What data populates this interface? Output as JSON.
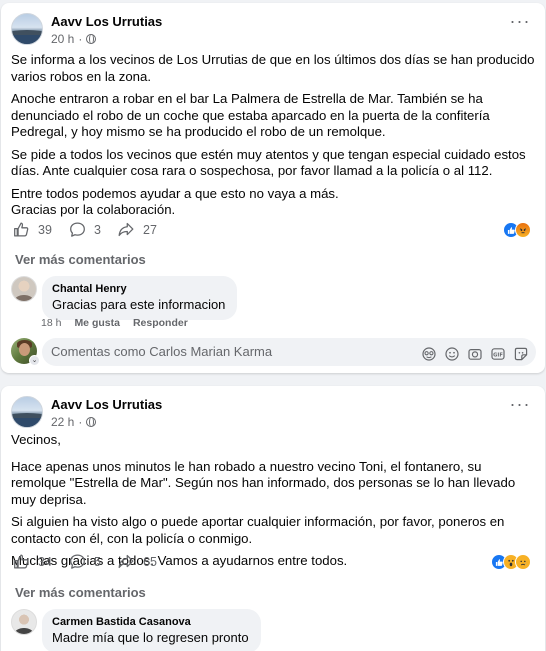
{
  "posts": [
    {
      "page_name": "Aavv Los Urrutias",
      "time": "20 h",
      "paragraphs": [
        "Se informa a los vecinos de Los Urrutias de que en los últimos dos días se han producido varios robos en la zona.",
        "Anoche entraron a robar en el bar La Palmera de Estrella de Mar. También se ha denunciado el robo de un coche que estaba aparcado en la puerta de la confitería Pedregal, y hoy mismo se ha producido el robo de un remolque.",
        "Se pide a todos los vecinos que estén muy atentos y que tengan especial cuidado estos días. Ante cualquier cosa rara o sospechosa, por favor llamad a la policía o al 112.",
        "Entre todos podemos ayudar a que esto no vaya a más.\nGracias por la colaboración."
      ],
      "likes": "39",
      "comments_count": "3",
      "shares": "27",
      "reactions": [
        "like-icon",
        "angry-icon"
      ],
      "more_comments": "Ver más comentarios",
      "comment": {
        "author": "Chantal Henry",
        "text": "Gracias para este informacion",
        "time": "18 h",
        "like_label": "Me gusta",
        "reply_label": "Responder"
      },
      "composer_placeholder": "Comentas como Carlos Marian Karma"
    },
    {
      "page_name": "Aavv Los Urrutias",
      "time": "22 h",
      "paragraphs": [
        "Vecinos,",
        "Hace apenas unos minutos le han robado a nuestro vecino Toni, el fontanero, su remolque \"Estrella de Mar\". Según nos han informado, dos personas se lo han llevado muy deprisa.",
        "Si alguien ha visto algo o puede aportar cualquier información, por favor, poneros en contacto con él, con la policía o conmigo.",
        "Muchas gracias a todos. Vamos a ayudarnos entre todos."
      ],
      "likes": "34",
      "comments_count": "5",
      "shares": "65",
      "reactions": [
        "like-icon",
        "wow-icon",
        "sad-icon"
      ],
      "more_comments": "Ver más comentarios",
      "comment": {
        "author": "Carmen Bastida Casanova",
        "text": "Madre mía que lo regresen pronto"
      }
    }
  ],
  "colors": {
    "background": "#f0f2f5",
    "card": "#ffffff",
    "secondary_text": "#65676b",
    "like_blue": "#1877f2"
  }
}
